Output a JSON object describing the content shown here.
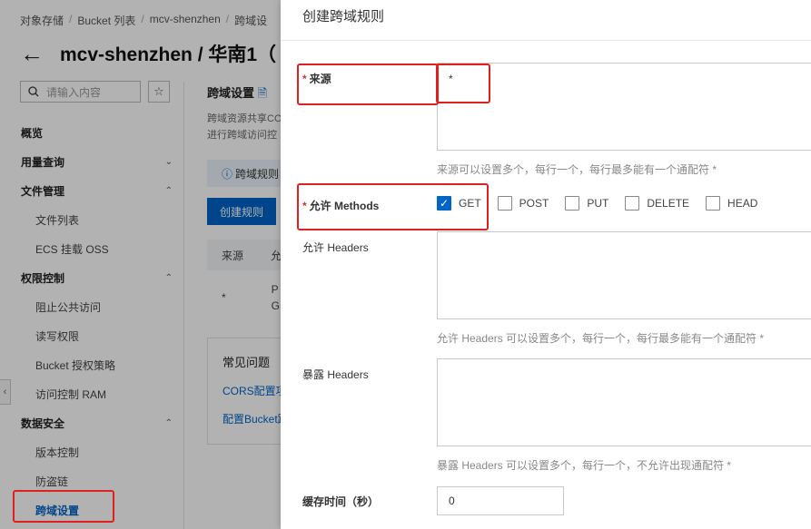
{
  "breadcrumb": [
    "对象存储",
    "Bucket 列表",
    "mcv-shenzhen",
    "跨域设"
  ],
  "header": {
    "title": "mcv-shenzhen / 华南1（"
  },
  "search": {
    "placeholder": "请输入内容"
  },
  "sidenav": {
    "items": [
      {
        "label": "概览",
        "type": "group"
      },
      {
        "label": "用量查询",
        "type": "group",
        "chevron": "down"
      },
      {
        "label": "文件管理",
        "type": "group",
        "chevron": "up"
      },
      {
        "label": "文件列表",
        "type": "sub"
      },
      {
        "label": "ECS 挂载 OSS",
        "type": "sub"
      },
      {
        "label": "权限控制",
        "type": "group",
        "chevron": "up"
      },
      {
        "label": "阻止公共访问",
        "type": "sub"
      },
      {
        "label": "读写权限",
        "type": "sub"
      },
      {
        "label": "Bucket 授权策略",
        "type": "sub"
      },
      {
        "label": "访问控制 RAM",
        "type": "sub"
      },
      {
        "label": "数据安全",
        "type": "group",
        "chevron": "up"
      },
      {
        "label": "版本控制",
        "type": "sub"
      },
      {
        "label": "防盗链",
        "type": "sub"
      },
      {
        "label": "跨域设置",
        "type": "sub",
        "active": true
      }
    ]
  },
  "content": {
    "title": "跨域设置",
    "desc_1": "跨域资源共享CO",
    "desc_2": "进行跨域访问控",
    "info": "跨域规则",
    "create_button": "创建规则",
    "table_header": "来源",
    "table_header_2": "允",
    "row_source": "*",
    "row_methods_1": "P",
    "row_methods_2": "G",
    "faq_title": "常见问题",
    "faq_link_1": "CORS配置项",
    "faq_link_2": "配置Bucket跨"
  },
  "drawer": {
    "title": "创建跨域规则",
    "origin": {
      "label": "来源",
      "value": "*",
      "hint": "来源可以设置多个，每行一个，每行最多能有一个通配符 *"
    },
    "methods": {
      "label": "允许 Methods",
      "options": [
        {
          "label": "GET",
          "checked": true
        },
        {
          "label": "POST",
          "checked": false
        },
        {
          "label": "PUT",
          "checked": false
        },
        {
          "label": "DELETE",
          "checked": false
        },
        {
          "label": "HEAD",
          "checked": false
        }
      ]
    },
    "allow_headers": {
      "label": "允许 Headers",
      "value": "",
      "hint": "允许 Headers 可以设置多个，每行一个，每行最多能有一个通配符 *"
    },
    "expose_headers": {
      "label": "暴露 Headers",
      "value": "",
      "hint": "暴露 Headers 可以设置多个，每行一个，不允许出现通配符 *"
    },
    "cache_time": {
      "label": "缓存时间（秒）",
      "value": "0"
    }
  },
  "colors": {
    "accent": "#0064c8",
    "highlight": "#e02020",
    "required": "#d93026"
  }
}
